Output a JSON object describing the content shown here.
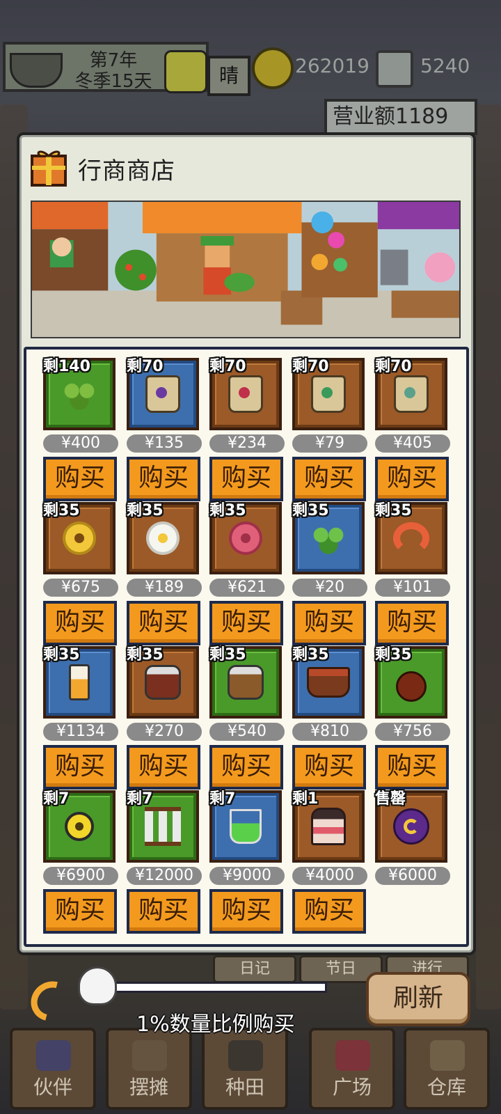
{
  "hud": {
    "year": "第7年",
    "season": "冬季15天",
    "weather": "晴",
    "coins": "262019",
    "gems": "5240",
    "revenue": "营业额1189"
  },
  "shop": {
    "title": "行商商店",
    "buy_label": "购买",
    "items": [
      {
        "stock": "剩140",
        "price": "¥400",
        "tile": "green",
        "icon": "clover-icon"
      },
      {
        "stock": "剩70",
        "price": "¥135",
        "tile": "blue",
        "icon": "seed-bag-purple-icon"
      },
      {
        "stock": "剩70",
        "price": "¥234",
        "tile": "brown",
        "icon": "seed-bag-red-icon"
      },
      {
        "stock": "剩70",
        "price": "¥79",
        "tile": "brown",
        "icon": "seed-bag-green-icon"
      },
      {
        "stock": "剩70",
        "price": "¥405",
        "tile": "brown",
        "icon": "seed-bag-teal-icon"
      },
      {
        "stock": "剩35",
        "price": "¥675",
        "tile": "brown",
        "icon": "sunflower-icon"
      },
      {
        "stock": "剩35",
        "price": "¥189",
        "tile": "brown",
        "icon": "daisy-icon"
      },
      {
        "stock": "剩35",
        "price": "¥621",
        "tile": "brown",
        "icon": "rose-icon"
      },
      {
        "stock": "剩35",
        "price": "¥20",
        "tile": "blue",
        "icon": "seaweed-icon"
      },
      {
        "stock": "剩35",
        "price": "¥101",
        "tile": "brown",
        "icon": "shrimp-icon"
      },
      {
        "stock": "剩35",
        "price": "¥1134",
        "tile": "blue",
        "icon": "oil-bottle-icon"
      },
      {
        "stock": "剩35",
        "price": "¥270",
        "tile": "brown",
        "icon": "jam-jar-icon"
      },
      {
        "stock": "剩35",
        "price": "¥540",
        "tile": "green",
        "icon": "honey-jar-icon"
      },
      {
        "stock": "剩35",
        "price": "¥810",
        "tile": "blue",
        "icon": "fruit-basket-icon"
      },
      {
        "stock": "剩35",
        "price": "¥756",
        "tile": "green",
        "icon": "gourd-icon"
      },
      {
        "stock": "剩7",
        "price": "¥6900",
        "tile": "green",
        "icon": "gold-ring-icon"
      },
      {
        "stock": "剩7",
        "price": "¥12000",
        "tile": "green",
        "icon": "vials-rack-icon"
      },
      {
        "stock": "剩7",
        "price": "¥9000",
        "tile": "blue",
        "icon": "potion-flask-icon"
      },
      {
        "stock": "剩1",
        "price": "¥4000",
        "tile": "brown",
        "icon": "layer-cake-icon"
      },
      {
        "stock": "售罄",
        "price": "¥6000",
        "tile": "brown",
        "icon": "swirl-orb-icon",
        "sold_out": true
      }
    ]
  },
  "controls": {
    "slider_label": "1%数量比例购买",
    "refresh_label": "刷新"
  },
  "under_tabs": [
    "日记",
    "节日",
    "进行"
  ],
  "nav": [
    "伙伴",
    "摆摊",
    "种田",
    "广场",
    "仓库"
  ]
}
